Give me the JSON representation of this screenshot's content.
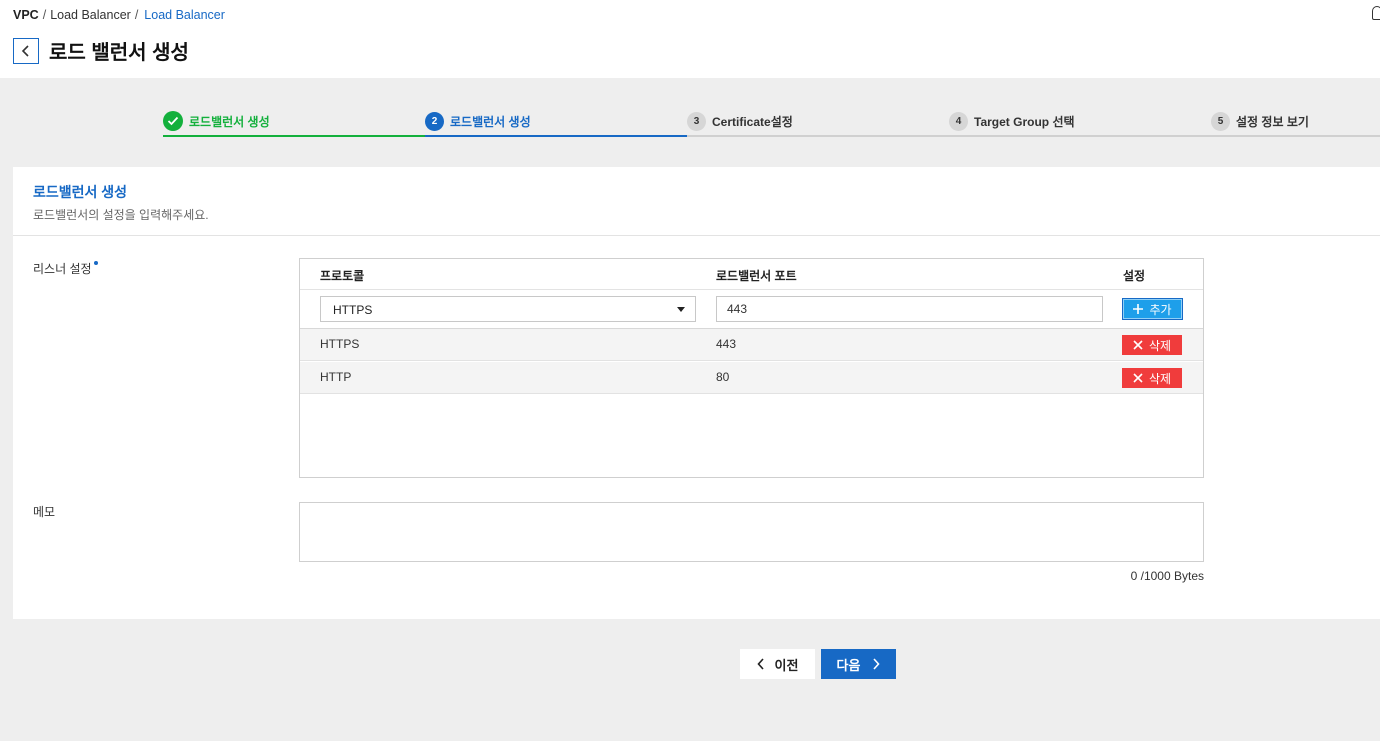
{
  "breadcrumb": {
    "root": "VPC",
    "mid": "Load Balancer",
    "current": "Load Balancer"
  },
  "page": {
    "title": "로드 밸런서 생성"
  },
  "stepper": {
    "steps": [
      {
        "num": "",
        "label": "로드밸런서 생성",
        "state": "done"
      },
      {
        "num": "2",
        "label": "로드밸런서 생성",
        "state": "active"
      },
      {
        "num": "3",
        "label": "Certificate설정",
        "state": "pending"
      },
      {
        "num": "4",
        "label": "Target Group 선택",
        "state": "pending"
      },
      {
        "num": "5",
        "label": "설정 정보 보기",
        "state": "pending"
      }
    ]
  },
  "card": {
    "title": "로드밸런서 생성",
    "description": "로드밸런서의 설정을 입력해주세요."
  },
  "listener": {
    "label": "리스너 설정",
    "headers": {
      "protocol": "프로토콜",
      "port": "로드밸런서 포트",
      "setting": "설정"
    },
    "protocol_selected": "HTTPS",
    "port_value": "443",
    "add_label": "추가",
    "rows": [
      {
        "protocol": "HTTPS",
        "port": "443",
        "delete_label": "삭제"
      },
      {
        "protocol": "HTTP",
        "port": "80",
        "delete_label": "삭제"
      }
    ]
  },
  "memo": {
    "label": "메모",
    "value": "",
    "byte_count": "0 /1000 Bytes"
  },
  "nav": {
    "prev_label": "이전",
    "next_label": "다음"
  },
  "colors": {
    "accent": "#1769c5",
    "success": "#13b03c",
    "danger": "#f03c3c",
    "add": "#1e9fea"
  }
}
